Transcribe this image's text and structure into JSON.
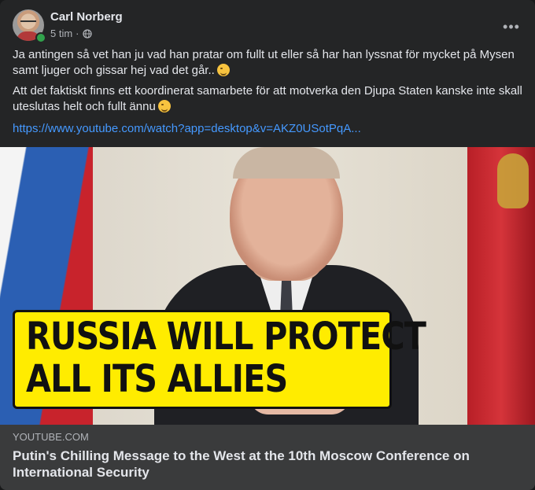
{
  "post": {
    "author": "Carl Norberg",
    "time": "5 tim",
    "separator": "·",
    "audience_icon": "globe-icon",
    "more_icon": "more-horizontal-icon",
    "more_label": "•••",
    "paragraphs": [
      "Ja antingen så vet han ju vad han pratar om fullt ut eller så har han lyssnat för mycket på Mysen samt ljuger och gissar hej vad det går..",
      "Att det faktiskt finns ett koordinerat samarbete för att motverka den Djupa Staten kanske inte skall uteslutas helt och fullt ännu"
    ],
    "emoji": "winking-face",
    "link": "https://www.youtube.com/watch?app=desktop&v=AKZ0USotPqA..."
  },
  "preview": {
    "thumbnail_text": [
      "RUSSIA WILL PROTECT",
      "ALL ITS ALLIES"
    ],
    "domain": "YOUTUBE.COM",
    "title": "Putin's Chilling Message to the West at the 10th Moscow Conference on International Security"
  },
  "colors": {
    "card_bg": "#242526",
    "text_primary": "#e4e6eb",
    "text_secondary": "#b0b3b8",
    "link": "#4599ff",
    "caption_bg": "#3a3b3c",
    "online": "#31a24c",
    "thumbnail_banner": "#ffec00"
  }
}
